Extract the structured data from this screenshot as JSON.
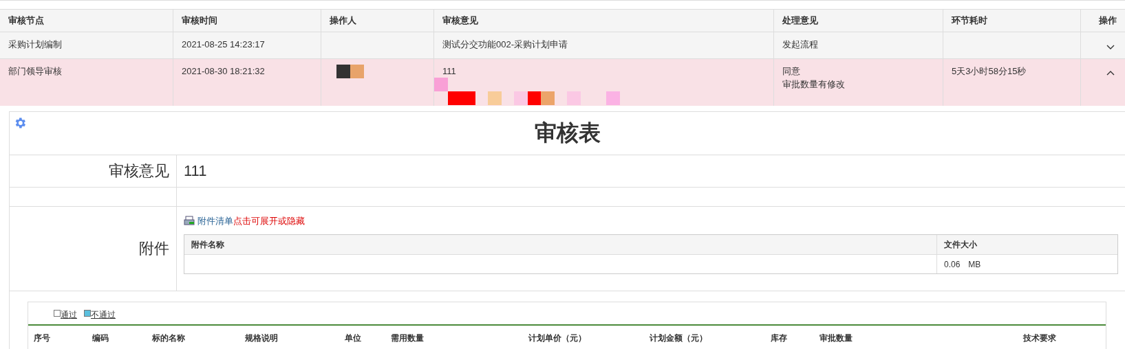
{
  "records": {
    "columns": [
      "审核节点",
      "审核时间",
      "操作人",
      "审核意见",
      "处理意见",
      "环节耗时",
      "操作"
    ],
    "rows": [
      {
        "node": "采购计划编制",
        "time": "2021-08-25 14:23:17",
        "redacted": false,
        "opinion": "测试分交功能002-采购计划申请",
        "handling": [
          "发起流程"
        ],
        "duration": "",
        "expanded": false
      },
      {
        "node": "部门领导审核",
        "time": "2021-08-30 18:21:32",
        "redacted": true,
        "opinion": "111",
        "handling": [
          "同意",
          "审批数量有修改"
        ],
        "duration": "5天3小时58分15秒",
        "expanded": true
      }
    ]
  },
  "form": {
    "title": "审核表",
    "opinion_label": "审核意见",
    "opinion_value": "111",
    "attachment_label": "附件",
    "attachment_link": "附件清单",
    "attachment_hint": "点击可展开或隐藏",
    "attachment_columns": [
      "附件名称",
      "文件大小"
    ],
    "attachment_rows": [
      {
        "name": "",
        "size": "0.06",
        "unit": "MB"
      }
    ]
  },
  "items": {
    "legend": [
      {
        "label": "通过",
        "color": "#ffffff"
      },
      {
        "label": "不通过",
        "color": "#5bc0de"
      }
    ],
    "columns": [
      "序号",
      "编码",
      "标的名称",
      "规格说明",
      "单位",
      "需用数量",
      "计划单价（元）",
      "计划金额（元）",
      "库存",
      "审批数量",
      "技术要求"
    ]
  }
}
